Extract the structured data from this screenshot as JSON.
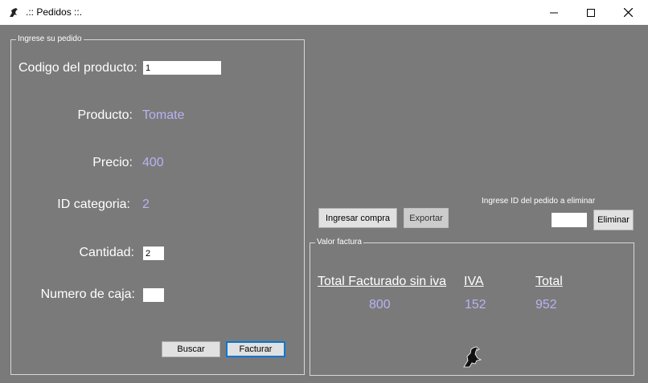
{
  "window": {
    "title": ".:: Pedidos ::.",
    "icon": "horse-logo-icon",
    "controls": [
      "minimize",
      "maximize",
      "close"
    ]
  },
  "order_group": {
    "legend": "Ingrese su pedido",
    "codigo_label": "Codigo del producto:",
    "codigo_value": "1",
    "producto_label": "Producto:",
    "producto_value": "Tomate",
    "precio_label": "Precio:",
    "precio_value": "400",
    "categoria_label": "ID categoria:",
    "categoria_value": "2",
    "cantidad_label": "Cantidad:",
    "cantidad_value": "2",
    "caja_label": "Numero de caja:",
    "caja_value": "",
    "buscar_label": "Buscar",
    "facturar_label": "Facturar"
  },
  "actions": {
    "ingresar_label": "Ingresar compra",
    "exportar_label": "Exportar",
    "eliminar_prompt": "Ingrese ID del pedido a eliminar",
    "eliminar_value": "",
    "eliminar_label": "Eliminar"
  },
  "invoice_group": {
    "legend": "Valor factura",
    "col_sin_iva": "Total Facturado sin iva",
    "col_iva": "IVA",
    "col_total": "Total",
    "val_sin_iva": "800",
    "val_iva": "152",
    "val_total": "952"
  },
  "colors": {
    "background": "#7a7a7a",
    "value_text": "#b7b3f2",
    "label_text": "#ffffff",
    "accent_border": "#0078d7"
  }
}
